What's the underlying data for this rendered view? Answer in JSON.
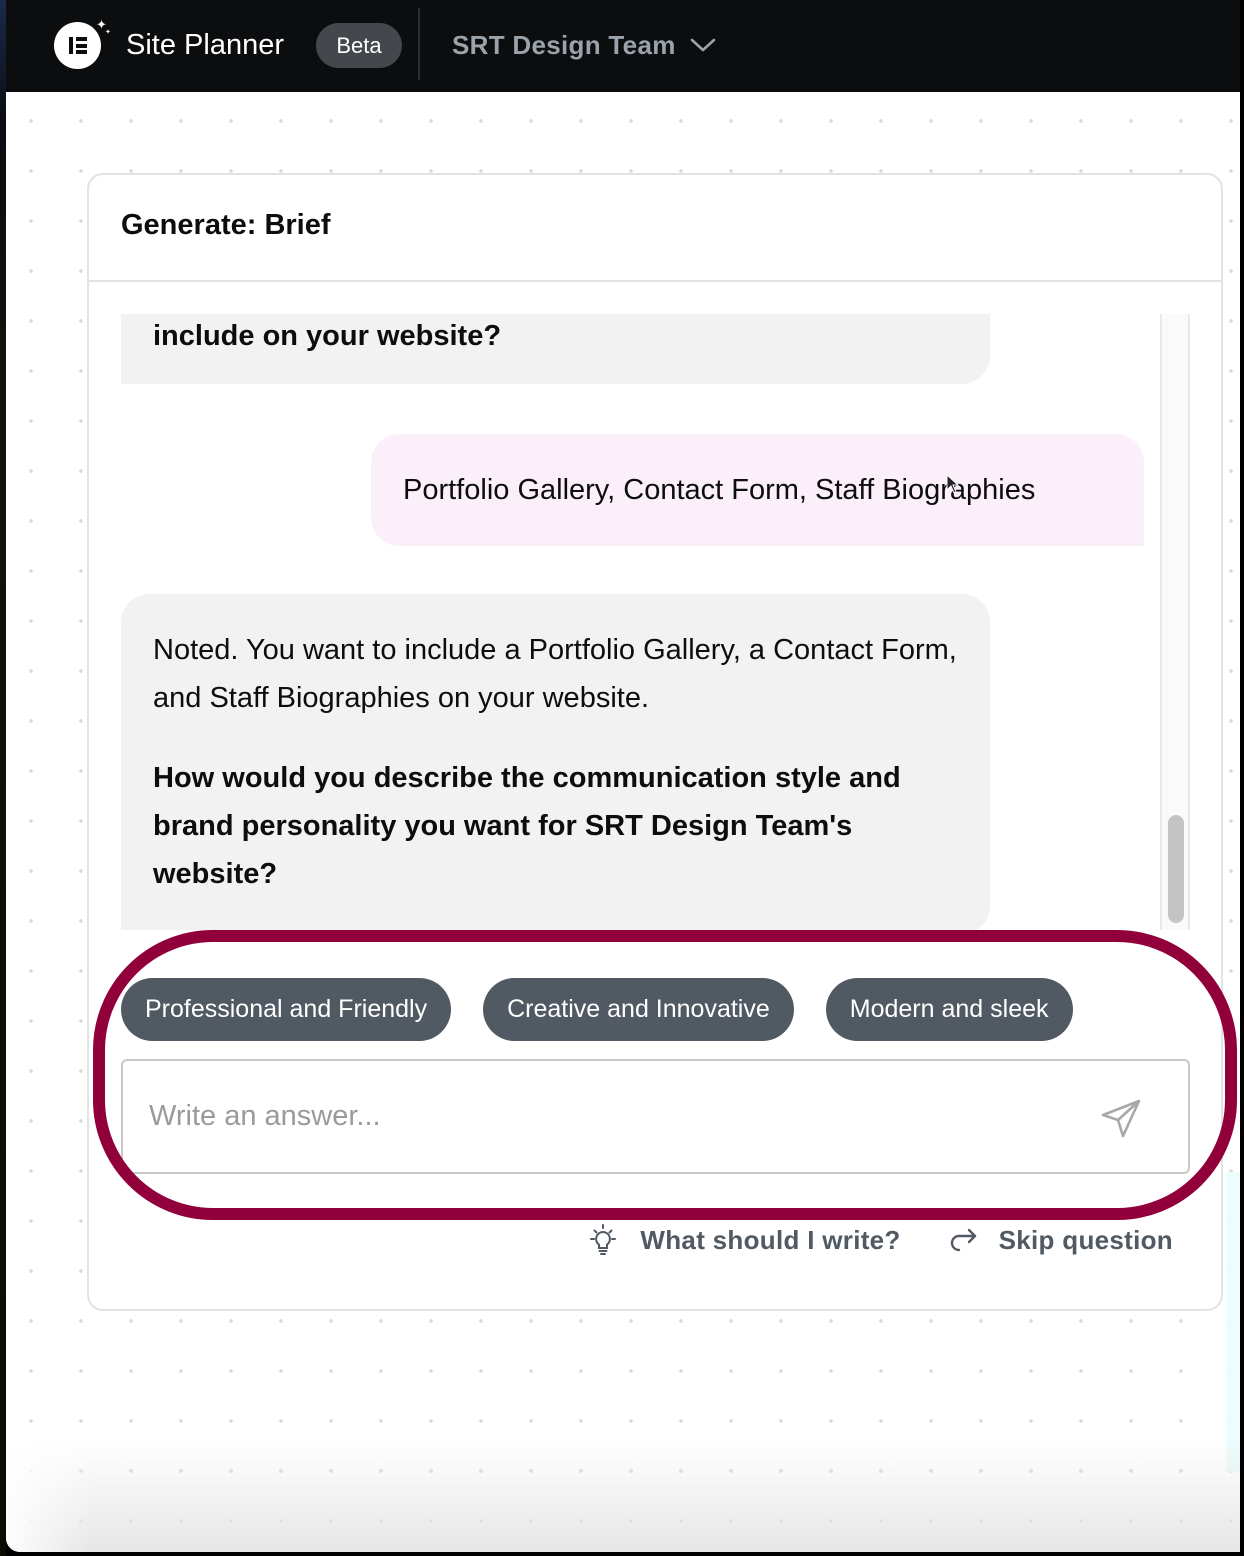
{
  "app": {
    "title": "Site Planner",
    "badge": "Beta",
    "team_name": "SRT Design Team",
    "logo_icon": "elementor-logo-icon",
    "team_dropdown_icon": "chevron-down-icon"
  },
  "panel": {
    "title": "Generate: Brief",
    "messages": [
      {
        "role": "assistant",
        "text": "include on your website?",
        "bold": true
      },
      {
        "role": "user",
        "text": "Portfolio Gallery, Contact Form, Staff Biographies"
      },
      {
        "role": "assistant",
        "text": "Noted. You want to include a Portfolio Gallery, a Contact Form, and Staff Biographies on your website.",
        "question": "How would you describe the communication style and brand personality you want for SRT Design Team's website?"
      }
    ],
    "suggestions": [
      "Professional and Friendly",
      "Creative and Innovative",
      "Modern and sleek"
    ],
    "answer_input": {
      "value": "",
      "placeholder": "Write an answer..."
    },
    "send_icon": "send-icon",
    "actions": {
      "help_label": "What should I write?",
      "help_icon": "lightbulb-icon",
      "skip_label": "Skip question",
      "skip_icon": "redo-arrow-icon"
    }
  },
  "colors": {
    "topbar": "#0c0d0e",
    "chip": "#515962",
    "assistant_bubble": "#f2f2f2",
    "user_bubble": "#fbf0fa",
    "highlight_ring": "#92003b"
  }
}
